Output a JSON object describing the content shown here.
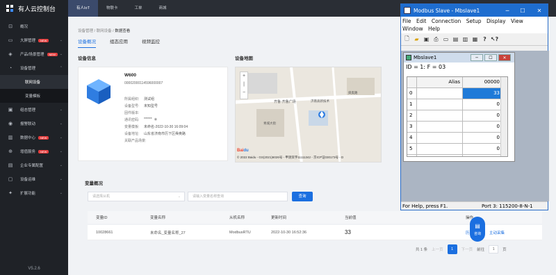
{
  "brand": {
    "title": "有人云控制台"
  },
  "sidebar": {
    "items": [
      {
        "label": "概况",
        "icon": "⊡"
      },
      {
        "label": "大屏管理",
        "icon": "▭",
        "hot": "NEW"
      },
      {
        "label": "产品/场景管理",
        "icon": "◈",
        "hot": "NEW"
      },
      {
        "label": "设备管理",
        "icon": "◔"
      }
    ],
    "sub": [
      {
        "label": "联网设备"
      },
      {
        "label": "变量模板"
      }
    ],
    "items2": [
      {
        "label": "组态管理",
        "icon": "▣"
      },
      {
        "label": "报警联动",
        "icon": "◉"
      },
      {
        "label": "数据中心",
        "icon": "▥",
        "hot": "NEW"
      },
      {
        "label": "增值服务",
        "icon": "⊕",
        "hot": "NEW"
      },
      {
        "label": "企业专属配置",
        "icon": "▤"
      },
      {
        "label": "设备运维",
        "icon": "▢"
      },
      {
        "label": "扩展功能",
        "icon": "✦"
      }
    ],
    "version": "V5.2.6"
  },
  "topnav": {
    "tabs": [
      "有人IoT",
      "物联卡",
      "工单",
      "商城"
    ]
  },
  "breadcrumb": {
    "a": "设备管理",
    "sep": "/",
    "b": "联网设备",
    "c": "数据查看"
  },
  "subtabs": [
    "设备概况",
    "组态应用",
    "视频监控"
  ],
  "device": {
    "section": "设备信息",
    "name": "W600",
    "sn": "00002000114596000007",
    "fields": [
      {
        "k": "所属组织:",
        "v": "测试组"
      },
      {
        "k": "设备型号:",
        "v": "未知型号"
      },
      {
        "k": "固件版本:",
        "v": ""
      },
      {
        "k": "通讯密码:",
        "v": "******"
      },
      {
        "k": "变量模板:",
        "v": "未命名-2022-10-30 16:09:04"
      },
      {
        "k": "设备地址:",
        "v": "山东省济南市历下区舜奥路"
      },
      {
        "k": "关联产品场景:",
        "v": ""
      }
    ]
  },
  "map": {
    "section": "设备地图",
    "copyright": "© 2022 Baidu - GS(2021)6026号 - 甲测资字11111342 - 京ICP证030173号 - D",
    "labels": {
      "plaza": "齐鲁·齐鲁广场",
      "park": "济南高新技术",
      "road": "舜奥路",
      "cinema": "青城大街"
    }
  },
  "variables": {
    "section": "变量概况",
    "select_placeholder": "请选择从机",
    "search_placeholder": "请输入变量名称查询",
    "query_label": "查询",
    "headers": [
      "变量ID",
      "变量名称",
      "从机名称",
      "更新时间",
      "当前值",
      "操作"
    ],
    "rows": [
      {
        "id": "10028661",
        "name": "未命名_变量名称_27",
        "slave": "ModbusRTU",
        "time": "2022-10-30 16:52:36",
        "value": "33",
        "op1": "历史查询",
        "op2": "主动采集"
      }
    ],
    "pager": {
      "total": "共 1 条",
      "prev": "上一页",
      "page": "1",
      "next": "下一页",
      "goto": "前往",
      "goto_val": "1",
      "unit": "页"
    }
  },
  "consult": {
    "label": "咨询"
  },
  "modbus": {
    "title": "Modbus Slave - Mbslave1",
    "menu": [
      "File",
      "Edit",
      "Connection",
      "Setup",
      "Display",
      "View",
      "Window",
      "Help"
    ],
    "child_title": "Mbslave1",
    "id_line": "ID = 1: F = 03",
    "grid_header": {
      "alias": "Alias",
      "addr": "00000"
    },
    "rows": [
      {
        "i": "0",
        "v": "33"
      },
      {
        "i": "1",
        "v": "0"
      },
      {
        "i": "2",
        "v": "0"
      },
      {
        "i": "3",
        "v": "0"
      },
      {
        "i": "4",
        "v": "0"
      },
      {
        "i": "5",
        "v": "0"
      },
      {
        "i": "6",
        "v": "0"
      }
    ],
    "status_left": "For Help, press F1.",
    "status_right": "Port 3: 115200-8-N-1"
  }
}
